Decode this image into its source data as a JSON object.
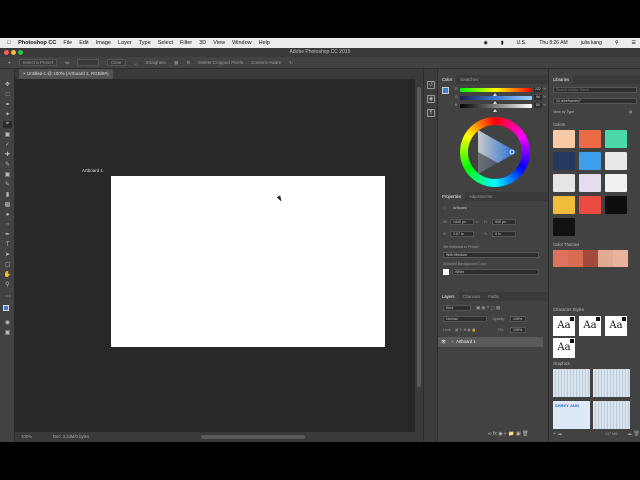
{
  "menubar": {
    "app": "Photoshop CC",
    "items": [
      "File",
      "Edit",
      "Image",
      "Layer",
      "Type",
      "Select",
      "Filter",
      "3D",
      "View",
      "Window",
      "Help"
    ],
    "status_left": "U.S.",
    "clock": "Thu 8:26 AM",
    "user": "julia kang"
  },
  "window_title": "Adobe Photoshop CC 2019",
  "options_bar": {
    "preset": "Select a Preset",
    "w_label": "W:",
    "h_label": "H:",
    "clear_label": "Clear",
    "straighten_label": "Straighten",
    "delete_label": "Delete Cropped Pixels",
    "content_aware_label": "Content-Aware"
  },
  "document_tab": "Untitled-1 @ 100% (Artboard 1, RGB/8#)",
  "artboard_label": "Artboard 1",
  "status_bar": {
    "zoom": "100%",
    "doc_info": "Doc: 3.34M/0 bytes"
  },
  "color_panel": {
    "tabs": [
      "Color",
      "Swatches"
    ],
    "channels": [
      {
        "label": "R",
        "value": "222"
      },
      {
        "label": "G",
        "value": "96"
      },
      {
        "label": "B",
        "value": "80"
      }
    ],
    "unit": "%"
  },
  "properties_panel": {
    "tabs": [
      "Properties",
      "Adjustments"
    ],
    "type_label": "Artboard",
    "w_label": "W:",
    "w_value": "1440 px",
    "h_label": "H:",
    "h_value": "900 px",
    "x_label": "X:",
    "x_value": "2.67 in",
    "y_label": "Y:",
    "y_value": "0 in",
    "preset_label": "Set Artboard to Preset:",
    "preset_value": "Web Medium",
    "bg_label": "Artboard Background Color:",
    "bg_value": "White"
  },
  "layers_panel": {
    "tabs": [
      "Layers",
      "Channels",
      "Paths"
    ],
    "kind_label": "Kind",
    "blend_mode": "Normal",
    "opacity_label": "Opacity:",
    "opacity_value": "100%",
    "lock_label": "Lock:",
    "fill_label": "Fill:",
    "fill_value": "100%",
    "layers": [
      {
        "name": "Artboard 1"
      }
    ]
  },
  "libraries_panel": {
    "tab": "Libraries",
    "search_placeholder": "Search Adobe Stock",
    "library_name": "14-wireframes?",
    "view_by": "View by Type",
    "colors_header": "Colors",
    "swatches": [
      "#f7c9a4",
      "#ec6a44",
      "#4cd8a6",
      "#243a5e",
      "#3ea0ea",
      "#e8e8e8",
      "#e5e5e5",
      "#e4dcef",
      "#f1f1f1",
      "#f0bc3a",
      "#ea4a3f",
      "#0e0e0e",
      "#111111"
    ],
    "color_themes_header": "Color Themes",
    "theme_colors": [
      "#e0715c",
      "#d96b52",
      "#a44a3a",
      "#e2a993",
      "#eab19b"
    ],
    "char_styles_header": "Character Styles",
    "char_styles": [
      "Aa",
      "Aa",
      "Aa",
      "Aa"
    ],
    "graphics_header": "Graphics",
    "graphic_caption": "SHREY JAIN",
    "size_label": "137 MB"
  }
}
